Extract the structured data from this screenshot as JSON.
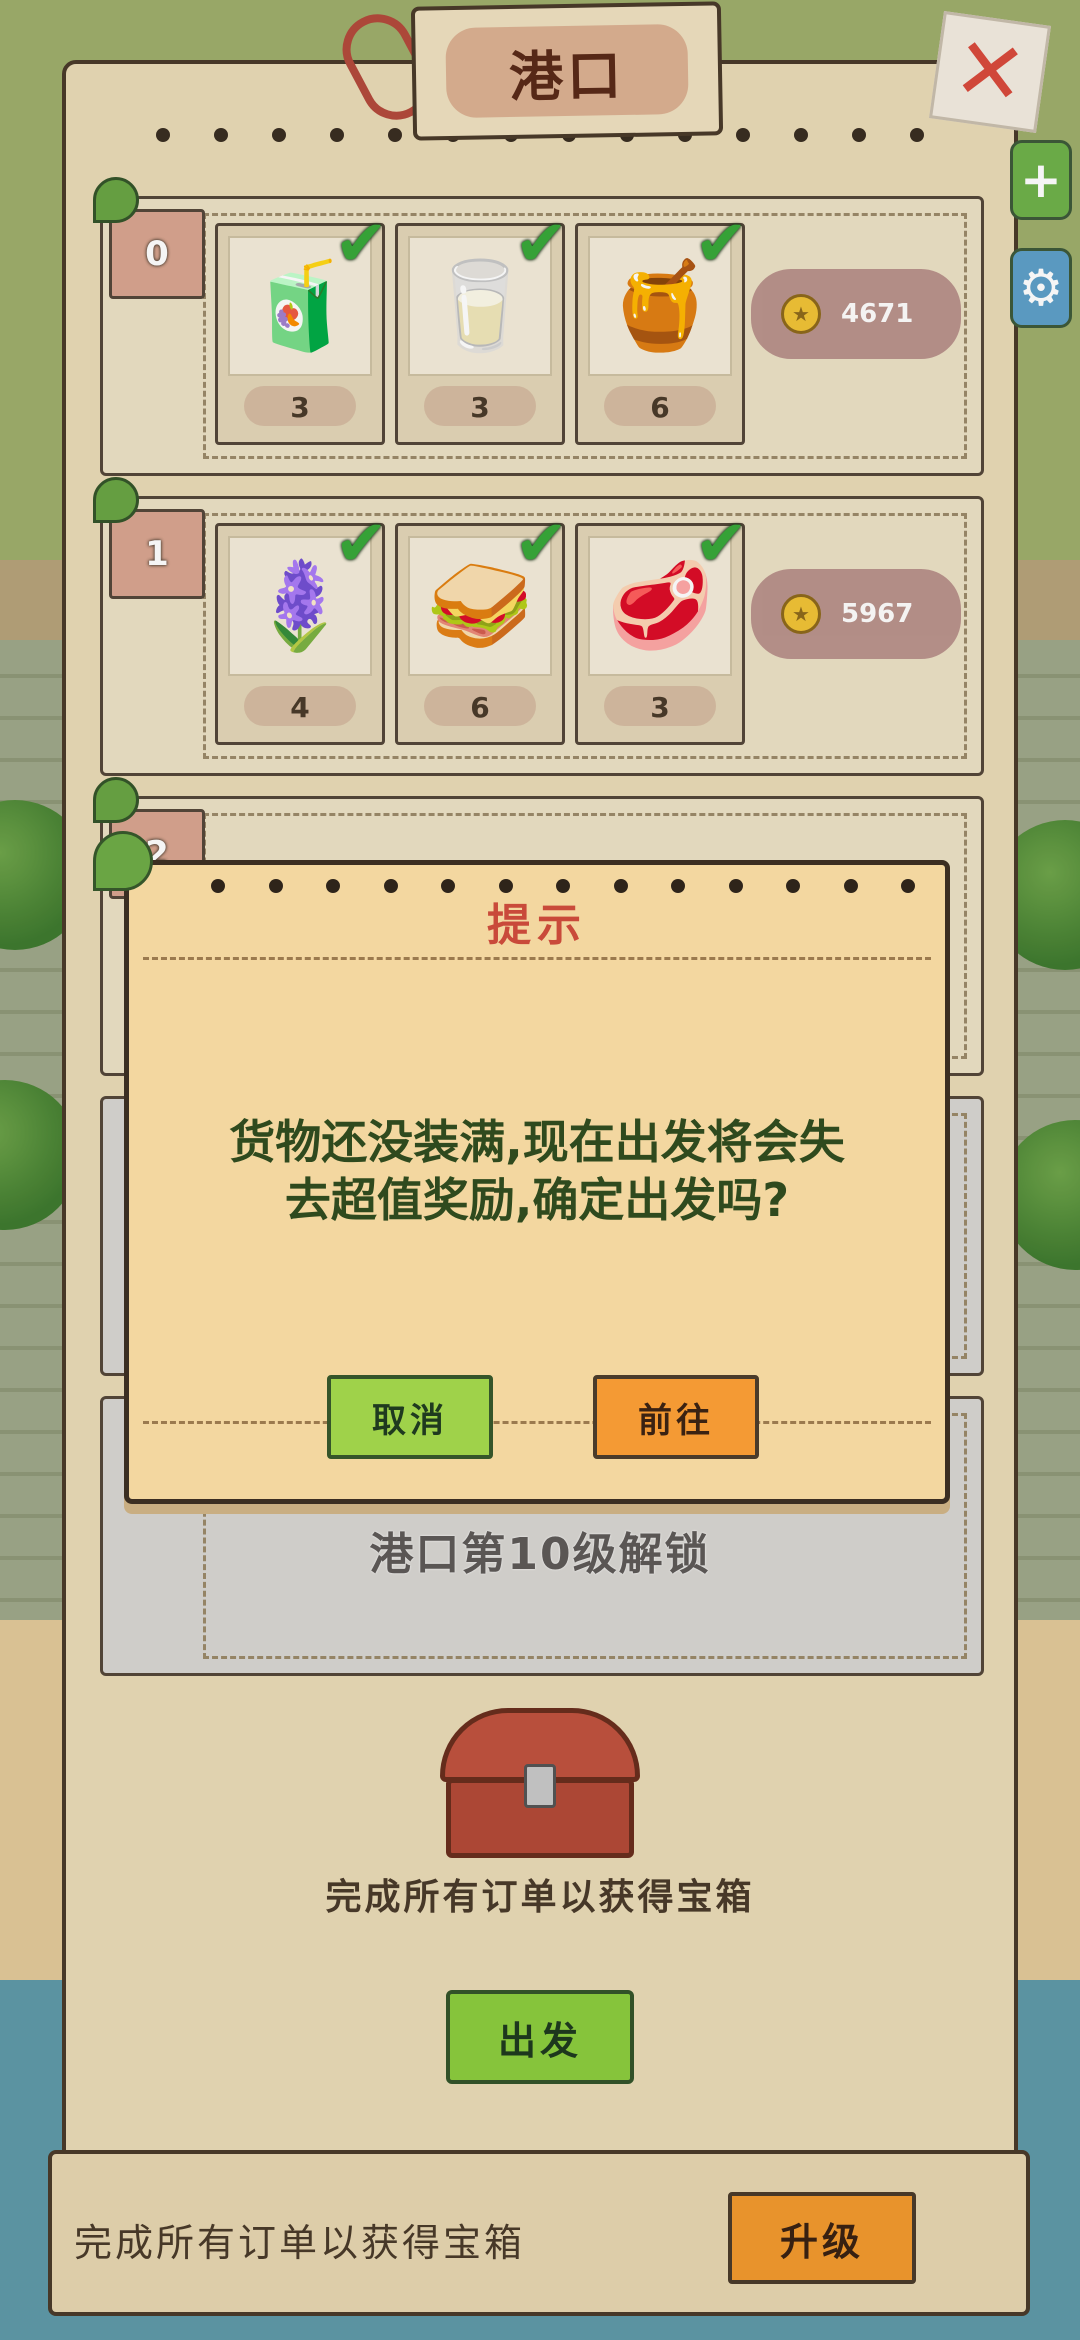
{
  "header": {
    "title": "港口"
  },
  "orders": [
    {
      "index": "0",
      "items": [
        {
          "name": "juice-icon",
          "glyph": "🧃",
          "qty": "3"
        },
        {
          "name": "milk-jar-icon",
          "glyph": "🥛",
          "qty": "3"
        },
        {
          "name": "jam-jar-icon",
          "glyph": "🍯",
          "qty": "6"
        }
      ],
      "reward": "4671"
    },
    {
      "index": "1",
      "items": [
        {
          "name": "lavender-icon",
          "glyph": "🪻",
          "qty": "4"
        },
        {
          "name": "toast-icon",
          "glyph": "🥪",
          "qty": "6"
        },
        {
          "name": "steak-icon",
          "glyph": "🥩",
          "qty": "3"
        }
      ],
      "reward": "5967"
    },
    {
      "index": "2"
    }
  ],
  "locked_row": {
    "text": "港口第10级解锁"
  },
  "chest": {
    "caption": "完成所有订单以获得宝箱"
  },
  "depart_label": "出发",
  "bottom_bar": {
    "text": "完成所有订单以获得宝箱",
    "upgrade_label": "升级"
  },
  "modal": {
    "title": "提示",
    "message_line1": "货物还没装满,现在出发将会失",
    "message_line2": "去超值奖励,确定出发吗?",
    "cancel_label": "取消",
    "go_label": "前往"
  },
  "icons": {
    "close": "close-icon",
    "plus": "plus-icon",
    "gear": "gear-icon",
    "check": "check-icon",
    "coin": "coin-icon",
    "chest": "treasure-chest-icon"
  },
  "colors": {
    "title_red": "#c94a3a",
    "message_green": "#2f4a1e",
    "cancel_green": "#9fd24a",
    "go_orange": "#f49a34"
  }
}
